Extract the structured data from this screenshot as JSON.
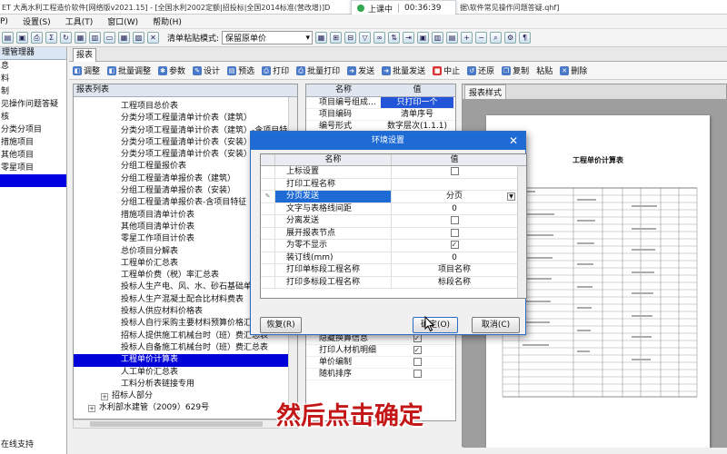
{
  "window": {
    "title_left": "ET 大禹水利工程造价软件[网络版v2021.15] - [全国水利2002定额|招投标|全国2014标准(营改增)]D",
    "title_right": "据\\软件常见操作问题答疑.qhf]"
  },
  "meeting": {
    "status": "上课中",
    "time": "00:36:39"
  },
  "menu": [
    "P)",
    "设置(S)",
    "工具(T)",
    "窗口(W)",
    "帮助(H)"
  ],
  "toolbar": {
    "paste_mode_label": "清单粘贴模式:",
    "paste_mode_value": "保留原单价"
  },
  "left_panel": {
    "title": "理管理器",
    "items": [
      "息",
      "料",
      "制",
      "见操作问题答疑",
      "核",
      "分类分项目",
      "措施项目",
      "其他项目",
      "零星项目",
      ""
    ],
    "selected_index": 9,
    "bottom": "在线支持"
  },
  "tab": {
    "label": "报表"
  },
  "actions": [
    "调整",
    "批量调整",
    "参数",
    "设计",
    "预选",
    "打印",
    "批量打印",
    "发送",
    "批量发送",
    "中止",
    "还原",
    "复制",
    "粘贴",
    "删除"
  ],
  "report_list": {
    "title": "报表列表",
    "rows": [
      {
        "label": "工程项目总价表",
        "level": 1
      },
      {
        "label": "分类分项工程量清单计价表（建筑）",
        "level": 1
      },
      {
        "label": "分类分项工程量清单计价表（建筑）-含项目特征",
        "level": 1
      },
      {
        "label": "分类分项工程量清单计价表（安装）",
        "level": 1
      },
      {
        "label": "分类分项工程量清单计价表（安装）-含项目特征",
        "level": 1
      },
      {
        "label": "分组工程量报价表",
        "level": 1
      },
      {
        "label": "分组工程量清单报价表（建筑）",
        "level": 1
      },
      {
        "label": "分组工程量清单报价表（安装）",
        "level": 1
      },
      {
        "label": "分组工程量清单报价表-含项目特征",
        "level": 1
      },
      {
        "label": "措施项目清单计价表",
        "level": 1
      },
      {
        "label": "其他项目清单计价表",
        "level": 1
      },
      {
        "label": "零星工作项目计价表",
        "level": 1
      },
      {
        "label": "总价项目分解表",
        "level": 1
      },
      {
        "label": "工程单价汇总表",
        "level": 1
      },
      {
        "label": "工程单价费（税）率汇总表",
        "level": 1
      },
      {
        "label": "投标人生产电、风、水、砂石基础单价汇总表",
        "level": 1
      },
      {
        "label": "投标人生产混凝土配合比材料费表",
        "level": 1
      },
      {
        "label": "投标人供应材料价格表",
        "level": 1
      },
      {
        "label": "投标人自行采购主要材料预算价格汇总表",
        "level": 1
      },
      {
        "label": "招标人提供施工机械台时（班）费汇总表",
        "level": 1
      },
      {
        "label": "投标人自备施工机械台时（班）费汇总表",
        "level": 1
      },
      {
        "label": "工程单价计算表",
        "level": 1
      },
      {
        "label": "人工单价汇总表",
        "level": 1
      },
      {
        "label": "工料分析表链接专用",
        "level": 1
      },
      {
        "label": "招标人部分",
        "level": 0
      },
      {
        "label": "水利部水建管（2009）629号",
        "level": -1
      }
    ],
    "selected_index": 21
  },
  "property_panel": {
    "col_name": "名称",
    "col_value": "值",
    "rows": [
      {
        "name": "项目编号组成...",
        "value": "只打印一个",
        "highlight": true
      },
      {
        "name": "项目编码",
        "value": "清单序号"
      },
      {
        "name": "编号形式",
        "value": "数字层次(1.1.1)"
      },
      {
        "name": "",
        "value": ""
      },
      {
        "name": "",
        "value": ""
      },
      {
        "name": "",
        "value": ""
      },
      {
        "name": "",
        "value": ""
      },
      {
        "name": "",
        "value": ""
      },
      {
        "name": "",
        "value": ""
      },
      {
        "name": "",
        "value": ""
      },
      {
        "name": "",
        "value": ""
      },
      {
        "name": "",
        "value": ""
      },
      {
        "name": "",
        "value": ""
      },
      {
        "name": "",
        "value": ""
      },
      {
        "name": "",
        "value": ""
      },
      {
        "name": "",
        "value": ""
      },
      {
        "name": "",
        "value": ""
      },
      {
        "name": "",
        "value": ""
      },
      {
        "name": "",
        "value": ""
      },
      {
        "name": "",
        "value": ""
      },
      {
        "name": "隐藏换算信息",
        "value": "",
        "checkbox": true,
        "checked": true
      },
      {
        "name": "打印人材机明细",
        "value": "",
        "checkbox": true,
        "checked": true
      },
      {
        "name": "单价编制",
        "value": "",
        "checkbox": true,
        "checked": false
      },
      {
        "name": "随机排序",
        "value": "",
        "checkbox": true,
        "checked": false
      }
    ]
  },
  "preview": {
    "tab": "报表样式",
    "paper_title": "工程单价计算表"
  },
  "dialog": {
    "title": "环境设置",
    "col_name": "名称",
    "col_value": "值",
    "rows": [
      {
        "name": "上标设置",
        "type": "checkbox",
        "checked": false
      },
      {
        "name": "打印工程名称",
        "type": "text",
        "value": ""
      },
      {
        "name": "分页发送",
        "type": "combo",
        "value": "分页",
        "selected": true
      },
      {
        "name": "文字与表格线间距",
        "type": "text",
        "value": "0"
      },
      {
        "name": "分离发送",
        "type": "checkbox",
        "checked": false
      },
      {
        "name": "展开报表节点",
        "type": "checkbox",
        "checked": false
      },
      {
        "name": "为零不显示",
        "type": "checkbox",
        "checked": true
      },
      {
        "name": "装订线(mm)",
        "type": "text",
        "value": "0"
      },
      {
        "name": "打印单标段工程名称",
        "type": "text",
        "value": "项目名称"
      },
      {
        "name": "打印多标段工程名称",
        "type": "text",
        "value": "标段名称"
      }
    ],
    "btn_restore": "恢复(R)",
    "btn_ok": "确定(O)",
    "btn_cancel": "取消(C)"
  },
  "caption": "然后点击确定"
}
